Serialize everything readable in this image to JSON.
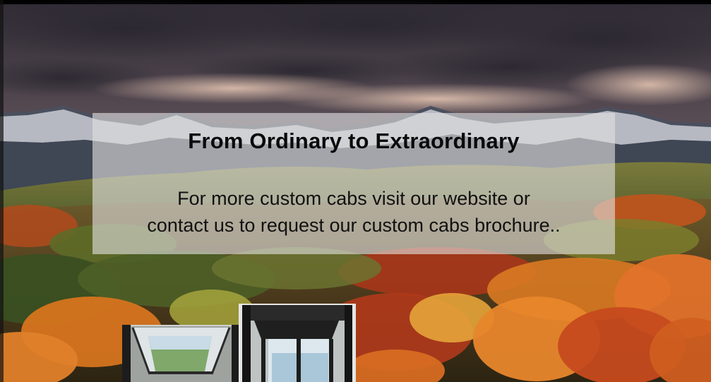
{
  "promo": {
    "title": "From Ordinary to Extraordinary",
    "body_line_1": "For more custom cabs visit our website or",
    "body_line_2": "contact us to request our custom cabs brochure.."
  },
  "colors": {
    "panel_tint": "#e1e1e1",
    "text": "#0a0a0a",
    "sky_top": "#3b3540",
    "sky_glow": "#e9c2b0",
    "foliage_orange": "#d9621f",
    "foliage_green": "#3f5a24"
  }
}
